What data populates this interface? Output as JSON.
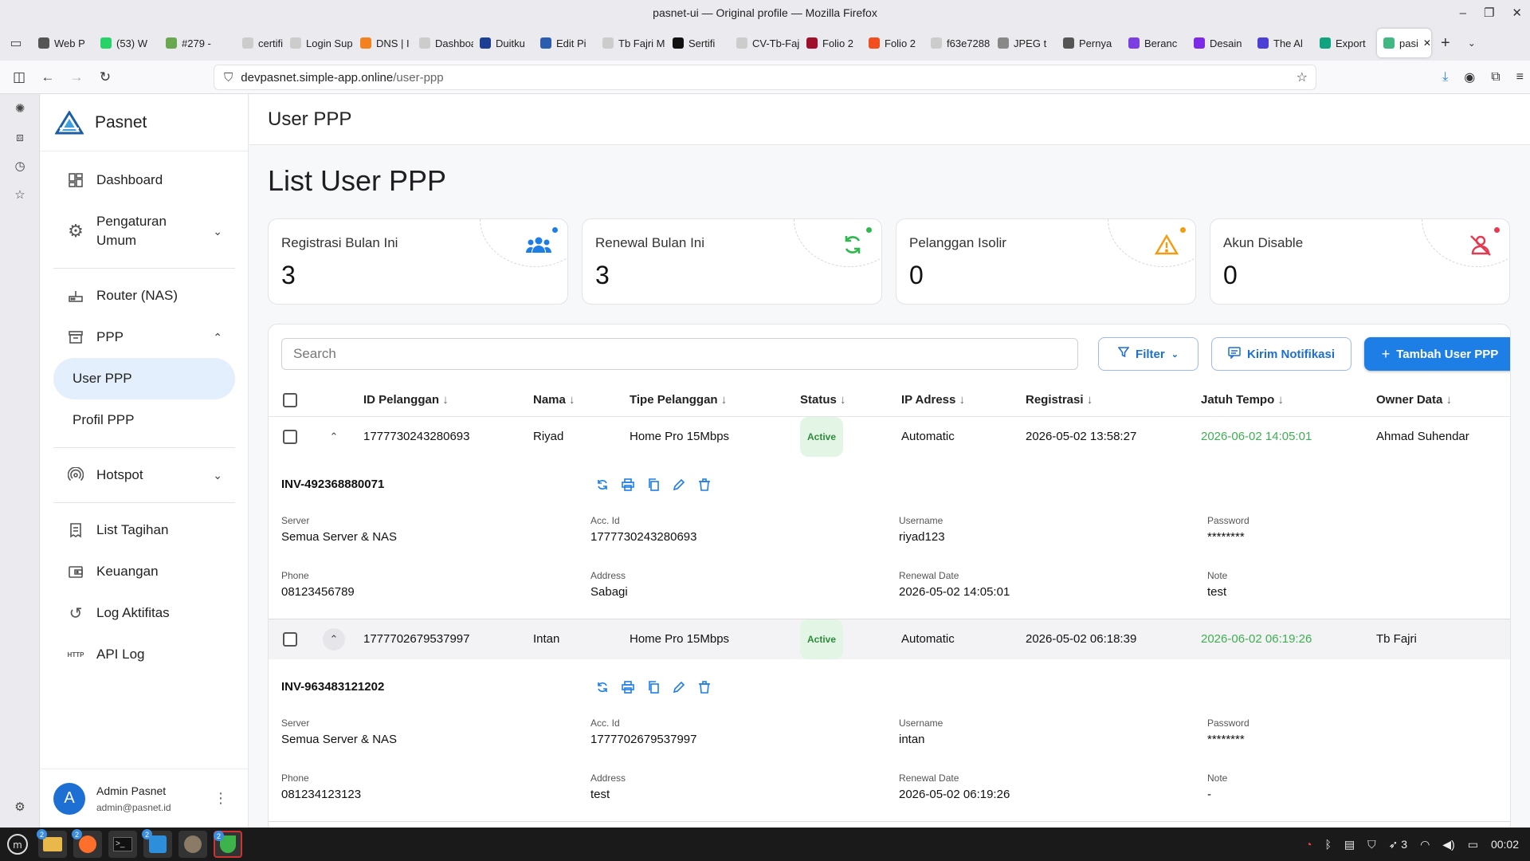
{
  "window": {
    "title": "pasnet-ui — Original profile — Mozilla Firefox"
  },
  "tabs": [
    {
      "label": "Web P",
      "color": "#555555"
    },
    {
      "label": "(53) W",
      "color": "#25d366"
    },
    {
      "label": "#279 -",
      "color": "#6aa84f"
    },
    {
      "label": "certifi",
      "color": "#cccccc"
    },
    {
      "label": "Login Sup",
      "color": "#cccccc"
    },
    {
      "label": "DNS | I",
      "color": "#f48120"
    },
    {
      "label": "Dashboar",
      "color": "#cccccc"
    },
    {
      "label": "Duitku",
      "color": "#1c3f94"
    },
    {
      "label": "Edit Pi",
      "color": "#2a5db0"
    },
    {
      "label": "Tb Fajri M",
      "color": "#cccccc"
    },
    {
      "label": "Sertifi",
      "color": "#111111"
    },
    {
      "label": "CV-Tb-Faji",
      "color": "#cccccc"
    },
    {
      "label": "Folio 2",
      "color": "#a0102b"
    },
    {
      "label": "Folio 2",
      "color": "#f24e1e"
    },
    {
      "label": "f63e7288",
      "color": "#cccccc"
    },
    {
      "label": "JPEG t",
      "color": "#888888"
    },
    {
      "label": "Pernya",
      "color": "#555555"
    },
    {
      "label": "Beranc",
      "color": "#7b3fe4"
    },
    {
      "label": "Desain",
      "color": "#7d2ae8"
    },
    {
      "label": "The Al",
      "color": "#4b3fd6"
    },
    {
      "label": "Export",
      "color": "#10a37f"
    },
    {
      "label": "pasi",
      "color": "#41b883",
      "active": true
    }
  ],
  "url": {
    "domain": "devpasnet.simple-app.online",
    "path": "/user-ppp"
  },
  "sidebar": {
    "brand": "Pasnet",
    "items": {
      "dashboard": "Dashboard",
      "pengaturan": "Pengaturan Umum",
      "router": "Router (NAS)",
      "ppp": "PPP",
      "user_ppp": "User PPP",
      "profil_ppp": "Profil PPP",
      "hotspot": "Hotspot",
      "tagihan": "List Tagihan",
      "keuangan": "Keuangan",
      "log": "Log Aktifitas",
      "api_log": "API Log"
    },
    "user": {
      "initial": "A",
      "name": "Admin Pasnet",
      "email": "admin@pasnet.id"
    }
  },
  "page": {
    "topbar_title": "User PPP",
    "heading": "List User PPP"
  },
  "stats": [
    {
      "label": "Registrasi Bulan Ini",
      "value": "3",
      "icon": "users-icon",
      "color": "#1d7ee6"
    },
    {
      "label": "Renewal Bulan Ini",
      "value": "3",
      "icon": "refresh-icon",
      "color": "#2eb84d"
    },
    {
      "label": "Pelanggan Isolir",
      "value": "0",
      "icon": "warning-icon",
      "color": "#f39c12"
    },
    {
      "label": "Akun Disable",
      "value": "0",
      "icon": "user-off-icon",
      "color": "#e53950"
    }
  ],
  "toolbar": {
    "search_placeholder": "Search",
    "filter_label": "Filter",
    "notif_label": "Kirim Notifikasi",
    "add_label": "Tambah User PPP"
  },
  "table": {
    "columns": [
      "ID Pelanggan",
      "Nama",
      "Tipe Pelanggan",
      "Status",
      "IP Adress",
      "Registrasi",
      "Jatuh Tempo",
      "Owner Data"
    ],
    "field_labels": {
      "server": "Server",
      "acc_id": "Acc. Id",
      "username": "Username",
      "password": "Password",
      "phone": "Phone",
      "address": "Address",
      "renewal": "Renewal Date",
      "note": "Note"
    },
    "rows": [
      {
        "id": "1777730243280693",
        "nama": "Riyad",
        "tipe": "Home Pro 15Mbps",
        "status": "Active",
        "ip": "Automatic",
        "registrasi": "2026-05-02 13:58:27",
        "jatuh_tempo": "2026-06-02 14:05:01",
        "owner": "Ahmad Suhendar",
        "invoice": "INV-492368880071",
        "server": "Semua Server & NAS",
        "acc_id": "1777730243280693",
        "username": "riyad123",
        "password": "********",
        "phone": "08123456789",
        "address": "Sabagi",
        "renewal": "2026-05-02 14:05:01",
        "note": "test"
      },
      {
        "id": "1777702679537997",
        "nama": "Intan",
        "tipe": "Home Pro 15Mbps",
        "status": "Active",
        "ip": "Automatic",
        "registrasi": "2026-05-02 06:18:39",
        "jatuh_tempo": "2026-06-02 06:19:26",
        "owner": "Tb Fajri",
        "invoice": "INV-963483121202",
        "server": "Semua Server & NAS",
        "acc_id": "1777702679537997",
        "username": "intan",
        "password": "********",
        "phone": "081234123123",
        "address": "test",
        "renewal": "2026-05-02 06:19:26",
        "note": "-"
      }
    ]
  },
  "taskbar": {
    "clock": "00:02",
    "tray_count": "3"
  }
}
